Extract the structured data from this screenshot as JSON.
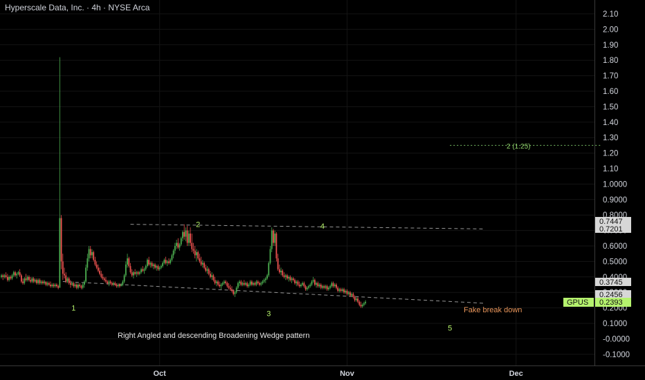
{
  "title": "Hyperscale Data, Inc. · 4h · NYSE Arca",
  "colors": {
    "background": "#000000",
    "up": "#4caf50",
    "down": "#ef5350",
    "wave_label": "#b6f26b",
    "trendline": "#bdbdbd",
    "fake_text": "#e8955a",
    "target_line": "#7cc46a",
    "last_price": "#b5f26e"
  },
  "annotations": {
    "pattern": "Right Angled and descending Broadening Wedge pattern",
    "fake": "Fake break down",
    "target": "2 (1.25)"
  },
  "price_labels": {
    "upper_a": "0.7447",
    "upper_b": "0.7201",
    "mid": "0.3745",
    "low": "0.2456",
    "ticker": "GPUS",
    "last": "0.2393"
  },
  "chart_data": {
    "type": "candlestick",
    "title": "Hyperscale Data, Inc. · 4h · NYSE Arca",
    "ylim": [
      -0.13,
      2.18
    ],
    "y_ticks": [
      "2.10",
      "2.00",
      "1.90",
      "1.80",
      "1.70",
      "1.60",
      "1.50",
      "1.40",
      "1.30",
      "1.20",
      "1.10",
      "1.0000",
      "0.9000",
      "0.8000",
      "0.7000",
      "0.6000",
      "0.5000",
      "0.4000",
      "0.3000",
      "0.2000",
      "0.1000",
      "-0.0000",
      "-0.1000"
    ],
    "x_ticks": [
      {
        "label": "Oct",
        "index": 103
      },
      {
        "label": "Nov",
        "index": 225
      },
      {
        "label": "Dec",
        "index": 335
      }
    ],
    "wave_labels": [
      {
        "label": "1",
        "index": 47,
        "value": 0.2
      },
      {
        "label": "2",
        "index": 128,
        "value": 0.74
      },
      {
        "label": "3",
        "index": 174,
        "value": 0.165
      },
      {
        "label": "4",
        "index": 209,
        "value": 0.73
      },
      {
        "label": "5",
        "index": 292,
        "value": 0.07
      }
    ],
    "trendlines": [
      {
        "name": "upper",
        "from": {
          "index": 84,
          "value": 0.74
        },
        "to": {
          "index": 314,
          "value": 0.71
        }
      },
      {
        "name": "lower",
        "from": {
          "index": 40,
          "value": 0.37
        },
        "to": {
          "index": 314,
          "value": 0.23
        }
      }
    ],
    "target_line": {
      "value": 1.25,
      "from_index": 292,
      "to_index": 390
    },
    "last_price": 0.2393,
    "ohlc": [
      [
        0.4,
        0.42,
        0.39,
        0.41
      ],
      [
        0.41,
        0.42,
        0.38,
        0.4
      ],
      [
        0.4,
        0.42,
        0.39,
        0.41
      ],
      [
        0.41,
        0.43,
        0.39,
        0.4
      ],
      [
        0.4,
        0.42,
        0.37,
        0.38
      ],
      [
        0.38,
        0.41,
        0.37,
        0.4
      ],
      [
        0.4,
        0.41,
        0.38,
        0.39
      ],
      [
        0.39,
        0.42,
        0.38,
        0.41
      ],
      [
        0.41,
        0.44,
        0.4,
        0.43
      ],
      [
        0.43,
        0.44,
        0.4,
        0.41
      ],
      [
        0.41,
        0.43,
        0.39,
        0.42
      ],
      [
        0.42,
        0.44,
        0.41,
        0.43
      ],
      [
        0.43,
        0.45,
        0.4,
        0.41
      ],
      [
        0.41,
        0.42,
        0.36,
        0.37
      ],
      [
        0.37,
        0.39,
        0.35,
        0.36
      ],
      [
        0.36,
        0.4,
        0.35,
        0.39
      ],
      [
        0.39,
        0.42,
        0.37,
        0.38
      ],
      [
        0.38,
        0.41,
        0.37,
        0.4
      ],
      [
        0.4,
        0.41,
        0.37,
        0.38
      ],
      [
        0.38,
        0.4,
        0.36,
        0.37
      ],
      [
        0.37,
        0.4,
        0.36,
        0.39
      ],
      [
        0.39,
        0.4,
        0.36,
        0.37
      ],
      [
        0.37,
        0.39,
        0.36,
        0.38
      ],
      [
        0.38,
        0.39,
        0.35,
        0.36
      ],
      [
        0.36,
        0.39,
        0.35,
        0.38
      ],
      [
        0.38,
        0.39,
        0.35,
        0.36
      ],
      [
        0.36,
        0.38,
        0.35,
        0.37
      ],
      [
        0.37,
        0.38,
        0.35,
        0.36
      ],
      [
        0.36,
        0.38,
        0.35,
        0.37
      ],
      [
        0.37,
        0.37,
        0.34,
        0.35
      ],
      [
        0.35,
        0.37,
        0.34,
        0.36
      ],
      [
        0.36,
        0.37,
        0.34,
        0.35
      ],
      [
        0.35,
        0.37,
        0.33,
        0.34
      ],
      [
        0.34,
        0.36,
        0.33,
        0.35
      ],
      [
        0.35,
        0.36,
        0.33,
        0.34
      ],
      [
        0.34,
        0.36,
        0.33,
        0.35
      ],
      [
        0.35,
        0.36,
        0.33,
        0.34
      ],
      [
        0.34,
        0.35,
        0.32,
        0.33
      ],
      [
        0.33,
        1.82,
        0.33,
        0.78
      ],
      [
        0.78,
        0.8,
        0.45,
        0.5
      ],
      [
        0.5,
        0.55,
        0.38,
        0.42
      ],
      [
        0.42,
        0.46,
        0.39,
        0.41
      ],
      [
        0.41,
        0.43,
        0.36,
        0.37
      ],
      [
        0.37,
        0.4,
        0.36,
        0.39
      ],
      [
        0.39,
        0.4,
        0.35,
        0.36
      ],
      [
        0.36,
        0.38,
        0.33,
        0.35
      ],
      [
        0.35,
        0.37,
        0.34,
        0.36
      ],
      [
        0.36,
        0.37,
        0.33,
        0.34
      ],
      [
        0.34,
        0.36,
        0.33,
        0.35
      ],
      [
        0.35,
        0.36,
        0.32,
        0.33
      ],
      [
        0.33,
        0.36,
        0.32,
        0.35
      ],
      [
        0.35,
        0.36,
        0.33,
        0.34
      ],
      [
        0.34,
        0.35,
        0.32,
        0.33
      ],
      [
        0.33,
        0.36,
        0.32,
        0.35
      ],
      [
        0.35,
        0.38,
        0.33,
        0.37
      ],
      [
        0.37,
        0.48,
        0.36,
        0.46
      ],
      [
        0.46,
        0.55,
        0.44,
        0.52
      ],
      [
        0.52,
        0.6,
        0.5,
        0.58
      ],
      [
        0.58,
        0.6,
        0.52,
        0.54
      ],
      [
        0.54,
        0.58,
        0.52,
        0.56
      ],
      [
        0.56,
        0.57,
        0.5,
        0.51
      ],
      [
        0.51,
        0.53,
        0.47,
        0.48
      ],
      [
        0.48,
        0.5,
        0.45,
        0.46
      ],
      [
        0.46,
        0.48,
        0.43,
        0.44
      ],
      [
        0.44,
        0.46,
        0.41,
        0.42
      ],
      [
        0.42,
        0.44,
        0.39,
        0.4
      ],
      [
        0.4,
        0.42,
        0.38,
        0.39
      ],
      [
        0.39,
        0.4,
        0.37,
        0.38
      ],
      [
        0.38,
        0.4,
        0.36,
        0.37
      ],
      [
        0.37,
        0.38,
        0.35,
        0.36
      ],
      [
        0.36,
        0.38,
        0.34,
        0.37
      ],
      [
        0.37,
        0.38,
        0.35,
        0.36
      ],
      [
        0.36,
        0.37,
        0.34,
        0.35
      ],
      [
        0.35,
        0.37,
        0.34,
        0.36
      ],
      [
        0.36,
        0.37,
        0.34,
        0.35
      ],
      [
        0.35,
        0.36,
        0.33,
        0.34
      ],
      [
        0.34,
        0.36,
        0.33,
        0.35
      ],
      [
        0.35,
        0.36,
        0.33,
        0.34
      ],
      [
        0.34,
        0.36,
        0.34,
        0.35
      ],
      [
        0.35,
        0.38,
        0.34,
        0.37
      ],
      [
        0.37,
        0.42,
        0.36,
        0.41
      ],
      [
        0.41,
        0.5,
        0.4,
        0.48
      ],
      [
        0.48,
        0.55,
        0.46,
        0.52
      ],
      [
        0.52,
        0.53,
        0.46,
        0.47
      ],
      [
        0.47,
        0.49,
        0.42,
        0.43
      ],
      [
        0.43,
        0.45,
        0.4,
        0.41
      ],
      [
        0.41,
        0.44,
        0.39,
        0.43
      ],
      [
        0.43,
        0.45,
        0.41,
        0.42
      ],
      [
        0.42,
        0.44,
        0.4,
        0.43
      ],
      [
        0.43,
        0.44,
        0.41,
        0.42
      ],
      [
        0.42,
        0.44,
        0.41,
        0.43
      ],
      [
        0.43,
        0.46,
        0.42,
        0.45
      ],
      [
        0.45,
        0.47,
        0.43,
        0.44
      ],
      [
        0.44,
        0.46,
        0.42,
        0.45
      ],
      [
        0.45,
        0.48,
        0.44,
        0.47
      ],
      [
        0.47,
        0.52,
        0.46,
        0.51
      ],
      [
        0.51,
        0.53,
        0.47,
        0.48
      ],
      [
        0.48,
        0.5,
        0.46,
        0.49
      ],
      [
        0.49,
        0.5,
        0.46,
        0.47
      ],
      [
        0.47,
        0.49,
        0.45,
        0.48
      ],
      [
        0.48,
        0.49,
        0.45,
        0.46
      ],
      [
        0.46,
        0.48,
        0.44,
        0.47
      ],
      [
        0.47,
        0.48,
        0.44,
        0.45
      ],
      [
        0.45,
        0.47,
        0.44,
        0.46
      ],
      [
        0.46,
        0.48,
        0.45,
        0.47
      ],
      [
        0.47,
        0.5,
        0.46,
        0.49
      ],
      [
        0.49,
        0.52,
        0.48,
        0.51
      ],
      [
        0.51,
        0.53,
        0.48,
        0.49
      ],
      [
        0.49,
        0.51,
        0.47,
        0.5
      ],
      [
        0.5,
        0.52,
        0.48,
        0.49
      ],
      [
        0.49,
        0.52,
        0.48,
        0.51
      ],
      [
        0.51,
        0.55,
        0.5,
        0.54
      ],
      [
        0.54,
        0.58,
        0.52,
        0.57
      ],
      [
        0.57,
        0.62,
        0.55,
        0.6
      ],
      [
        0.6,
        0.64,
        0.58,
        0.62
      ],
      [
        0.62,
        0.65,
        0.58,
        0.59
      ],
      [
        0.59,
        0.62,
        0.57,
        0.61
      ],
      [
        0.61,
        0.66,
        0.6,
        0.65
      ],
      [
        0.65,
        0.7,
        0.63,
        0.69
      ],
      [
        0.69,
        0.74,
        0.64,
        0.66
      ],
      [
        0.66,
        0.72,
        0.63,
        0.7
      ],
      [
        0.7,
        0.73,
        0.6,
        0.62
      ],
      [
        0.62,
        0.7,
        0.6,
        0.68
      ],
      [
        0.68,
        0.72,
        0.6,
        0.62
      ],
      [
        0.62,
        0.68,
        0.56,
        0.58
      ],
      [
        0.58,
        0.62,
        0.55,
        0.57
      ],
      [
        0.57,
        0.6,
        0.52,
        0.54
      ],
      [
        0.54,
        0.58,
        0.5,
        0.56
      ],
      [
        0.56,
        0.57,
        0.51,
        0.52
      ],
      [
        0.52,
        0.55,
        0.49,
        0.5
      ],
      [
        0.5,
        0.53,
        0.47,
        0.48
      ],
      [
        0.48,
        0.51,
        0.46,
        0.49
      ],
      [
        0.49,
        0.5,
        0.45,
        0.46
      ],
      [
        0.46,
        0.48,
        0.43,
        0.44
      ],
      [
        0.44,
        0.47,
        0.42,
        0.45
      ],
      [
        0.45,
        0.46,
        0.41,
        0.42
      ],
      [
        0.42,
        0.44,
        0.39,
        0.4
      ],
      [
        0.4,
        0.43,
        0.38,
        0.41
      ],
      [
        0.41,
        0.42,
        0.37,
        0.38
      ],
      [
        0.38,
        0.4,
        0.35,
        0.36
      ],
      [
        0.36,
        0.38,
        0.34,
        0.37
      ],
      [
        0.37,
        0.38,
        0.34,
        0.35
      ],
      [
        0.35,
        0.37,
        0.33,
        0.34
      ],
      [
        0.34,
        0.36,
        0.32,
        0.35
      ],
      [
        0.35,
        0.37,
        0.34,
        0.36
      ],
      [
        0.36,
        0.38,
        0.35,
        0.37
      ],
      [
        0.37,
        0.38,
        0.35,
        0.36
      ],
      [
        0.36,
        0.37,
        0.33,
        0.34
      ],
      [
        0.34,
        0.36,
        0.32,
        0.33
      ],
      [
        0.33,
        0.35,
        0.31,
        0.32
      ],
      [
        0.32,
        0.34,
        0.3,
        0.31
      ],
      [
        0.31,
        0.32,
        0.28,
        0.29
      ],
      [
        0.29,
        0.31,
        0.27,
        0.3
      ],
      [
        0.3,
        0.34,
        0.29,
        0.33
      ],
      [
        0.33,
        0.37,
        0.32,
        0.36
      ],
      [
        0.36,
        0.38,
        0.34,
        0.37
      ],
      [
        0.37,
        0.38,
        0.34,
        0.35
      ],
      [
        0.35,
        0.37,
        0.34,
        0.36
      ],
      [
        0.36,
        0.38,
        0.34,
        0.35
      ],
      [
        0.35,
        0.37,
        0.34,
        0.36
      ],
      [
        0.36,
        0.37,
        0.33,
        0.34
      ],
      [
        0.34,
        0.36,
        0.33,
        0.35
      ],
      [
        0.35,
        0.38,
        0.34,
        0.37
      ],
      [
        0.37,
        0.38,
        0.34,
        0.35
      ],
      [
        0.35,
        0.37,
        0.34,
        0.36
      ],
      [
        0.36,
        0.37,
        0.34,
        0.35
      ],
      [
        0.35,
        0.38,
        0.34,
        0.37
      ],
      [
        0.37,
        0.38,
        0.35,
        0.36
      ],
      [
        0.36,
        0.37,
        0.34,
        0.35
      ],
      [
        0.35,
        0.37,
        0.34,
        0.36
      ],
      [
        0.36,
        0.38,
        0.35,
        0.37
      ],
      [
        0.37,
        0.39,
        0.36,
        0.38
      ],
      [
        0.38,
        0.4,
        0.36,
        0.39
      ],
      [
        0.39,
        0.42,
        0.38,
        0.41
      ],
      [
        0.41,
        0.5,
        0.4,
        0.49
      ],
      [
        0.49,
        0.6,
        0.48,
        0.58
      ],
      [
        0.58,
        0.72,
        0.56,
        0.7
      ],
      [
        0.7,
        0.71,
        0.6,
        0.62
      ],
      [
        0.62,
        0.7,
        0.6,
        0.68
      ],
      [
        0.68,
        0.69,
        0.5,
        0.52
      ],
      [
        0.52,
        0.55,
        0.44,
        0.45
      ],
      [
        0.45,
        0.48,
        0.42,
        0.43
      ],
      [
        0.43,
        0.46,
        0.41,
        0.44
      ],
      [
        0.44,
        0.45,
        0.4,
        0.41
      ],
      [
        0.41,
        0.43,
        0.39,
        0.4
      ],
      [
        0.4,
        0.42,
        0.38,
        0.41
      ],
      [
        0.41,
        0.42,
        0.38,
        0.39
      ],
      [
        0.39,
        0.41,
        0.37,
        0.4
      ],
      [
        0.4,
        0.41,
        0.37,
        0.38
      ],
      [
        0.38,
        0.4,
        0.36,
        0.39
      ],
      [
        0.39,
        0.4,
        0.37,
        0.38
      ],
      [
        0.38,
        0.39,
        0.35,
        0.36
      ],
      [
        0.36,
        0.38,
        0.34,
        0.37
      ],
      [
        0.37,
        0.38,
        0.34,
        0.35
      ],
      [
        0.35,
        0.37,
        0.33,
        0.34
      ],
      [
        0.34,
        0.36,
        0.33,
        0.35
      ],
      [
        0.35,
        0.37,
        0.34,
        0.36
      ],
      [
        0.36,
        0.37,
        0.33,
        0.34
      ],
      [
        0.34,
        0.35,
        0.31,
        0.32
      ],
      [
        0.32,
        0.34,
        0.31,
        0.33
      ],
      [
        0.33,
        0.35,
        0.32,
        0.34
      ],
      [
        0.34,
        0.36,
        0.33,
        0.35
      ],
      [
        0.35,
        0.38,
        0.34,
        0.37
      ],
      [
        0.37,
        0.4,
        0.36,
        0.38
      ],
      [
        0.38,
        0.39,
        0.34,
        0.35
      ],
      [
        0.35,
        0.37,
        0.33,
        0.36
      ],
      [
        0.36,
        0.37,
        0.33,
        0.34
      ],
      [
        0.34,
        0.36,
        0.33,
        0.35
      ],
      [
        0.35,
        0.36,
        0.32,
        0.33
      ],
      [
        0.33,
        0.35,
        0.32,
        0.34
      ],
      [
        0.34,
        0.35,
        0.32,
        0.33
      ],
      [
        0.33,
        0.35,
        0.32,
        0.34
      ],
      [
        0.34,
        0.35,
        0.31,
        0.32
      ],
      [
        0.32,
        0.34,
        0.31,
        0.33
      ],
      [
        0.33,
        0.35,
        0.32,
        0.34
      ],
      [
        0.34,
        0.37,
        0.33,
        0.36
      ],
      [
        0.36,
        0.37,
        0.33,
        0.34
      ],
      [
        0.34,
        0.36,
        0.33,
        0.35
      ],
      [
        0.35,
        0.36,
        0.32,
        0.33
      ],
      [
        0.33,
        0.34,
        0.3,
        0.31
      ],
      [
        0.31,
        0.33,
        0.3,
        0.32
      ],
      [
        0.32,
        0.33,
        0.3,
        0.31
      ],
      [
        0.31,
        0.33,
        0.3,
        0.32
      ],
      [
        0.32,
        0.33,
        0.29,
        0.3
      ],
      [
        0.3,
        0.32,
        0.29,
        0.31
      ],
      [
        0.31,
        0.32,
        0.28,
        0.29
      ],
      [
        0.29,
        0.31,
        0.28,
        0.3
      ],
      [
        0.3,
        0.31,
        0.27,
        0.28
      ],
      [
        0.28,
        0.3,
        0.27,
        0.29
      ],
      [
        0.29,
        0.3,
        0.26,
        0.27
      ],
      [
        0.27,
        0.28,
        0.24,
        0.25
      ],
      [
        0.25,
        0.27,
        0.24,
        0.26
      ],
      [
        0.26,
        0.27,
        0.23,
        0.24
      ],
      [
        0.24,
        0.25,
        0.21,
        0.22
      ],
      [
        0.22,
        0.24,
        0.2,
        0.21
      ],
      [
        0.21,
        0.23,
        0.2,
        0.22
      ],
      [
        0.22,
        0.24,
        0.21,
        0.23
      ],
      [
        0.23,
        0.25,
        0.22,
        0.2393
      ]
    ]
  }
}
